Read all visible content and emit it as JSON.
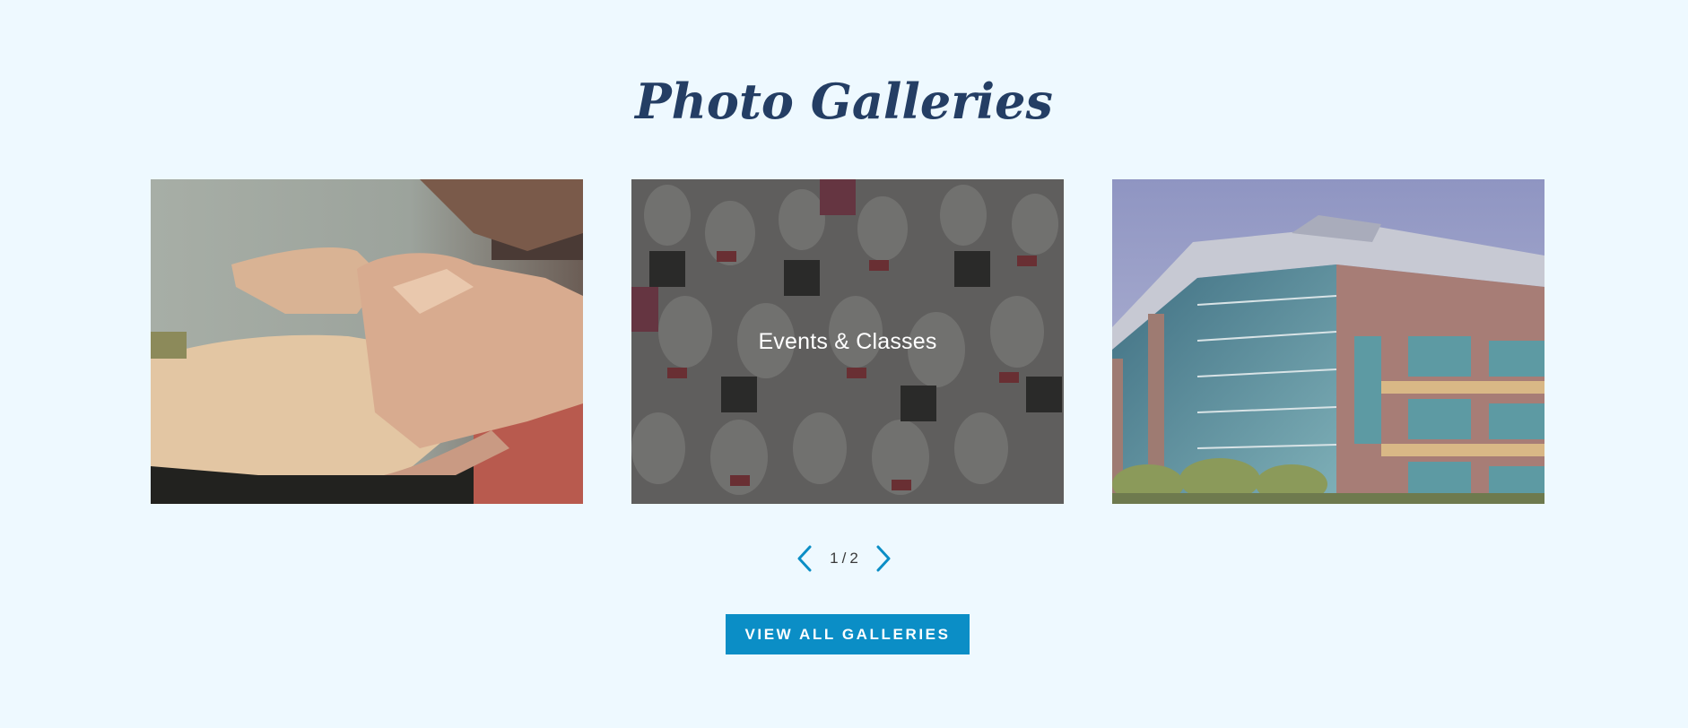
{
  "section": {
    "title": "Photo Galleries"
  },
  "galleries": [
    {
      "caption": "",
      "icon": "hands-photo",
      "hovered": false
    },
    {
      "caption": "Events & Classes",
      "icon": "race-runners-photo",
      "hovered": true
    },
    {
      "caption": "",
      "icon": "office-building-photo",
      "hovered": false
    }
  ],
  "pagination": {
    "current": "1",
    "separator": "/",
    "total": "2",
    "prev_icon": "chevron-left-icon",
    "next_icon": "chevron-right-icon"
  },
  "cta": {
    "label": "VIEW ALL GALLERIES"
  },
  "colors": {
    "background": "#eef9ff",
    "title": "#243e64",
    "accent": "#0b8ec6"
  }
}
